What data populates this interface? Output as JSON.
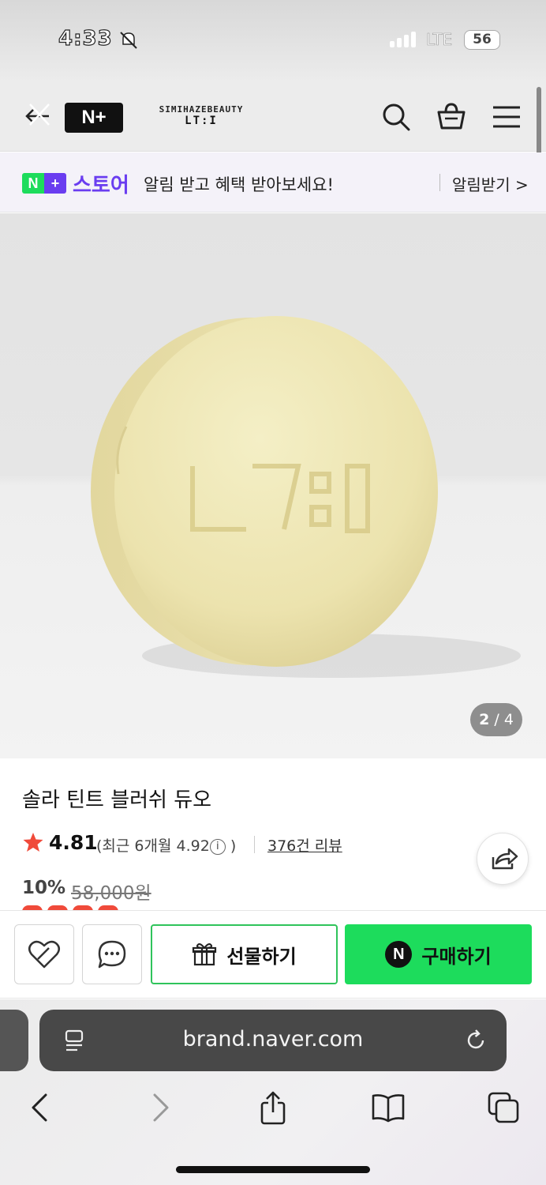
{
  "status": {
    "time": "4:33",
    "network": "LTE",
    "battery": "56"
  },
  "header": {
    "logo": "N+",
    "brand_name": "SIMIHAZEBEAUTY",
    "brand_mark": "LT:I"
  },
  "banner": {
    "badge": "N+",
    "store_label": "스토어",
    "message": "알림 받고 혜택 받아보세요!",
    "alarm_link": "알림받기 >"
  },
  "gallery": {
    "current": "2",
    "separator": "/",
    "total": "4"
  },
  "product": {
    "title": "솔라 틴트 블러쉬 듀오",
    "rating": "4.81",
    "recent_prefix": "(최근 6개월 4.92",
    "recent_suffix": ")",
    "review_count": "376건 리뷰",
    "discount": "10%",
    "original_price": "58,000원"
  },
  "actions": {
    "gift": "선물하기",
    "buy": "구매하기",
    "buy_badge": "N"
  },
  "browser": {
    "url": "brand.naver.com"
  },
  "colors": {
    "buy_green": "#1ddc5c",
    "store_purple": "#6a3df0",
    "star_red": "#f04a3a"
  }
}
